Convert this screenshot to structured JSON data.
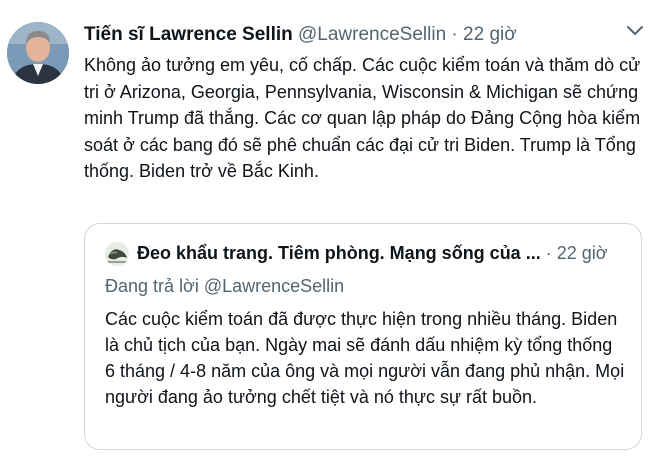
{
  "tweet": {
    "author_name": "Tiến sĩ Lawrence Sellin",
    "handle": "@LawrenceSellin",
    "separator": " · ",
    "time": "22 giờ",
    "text": "Không ảo tưởng em yêu, cố chấp. Các cuộc kiểm toán và thăm dò cử tri ở Arizona, Georgia, Pennsylvania, Wisconsin & Michigan sẽ chứng minh Trump đã thắng. Các cơ quan lập pháp do Đảng Cộng hòa kiểm soát ở các bang đó sẽ phê chuẩn các đại cử tri Biden. Trump là Tổng thống. Biden trở về Bắc Kinh.",
    "more_icon": "chevron-down-icon"
  },
  "quoted_tweet": {
    "author_name": "Đeo khẩu trang. Tiêm phòng. Mạng sống của ...",
    "separator": " · ",
    "time": "22 giờ",
    "reply_line": "Đang trả lời @LawrenceSellin",
    "text": "Các cuộc kiểm toán đã được thực hiện trong nhiều tháng. Biden là chủ tịch của bạn. Ngày mai sẽ đánh dấu nhiệm kỳ tổng thống 6 tháng / 4-8 năm của ông và mọi người vẫn đang phủ nhận. Mọi người đang ảo tưởng chết tiệt và nó thực sự rất buồn."
  },
  "colors": {
    "primary_text": "#0f1419",
    "secondary_text": "#536471",
    "border": "#cfd9de"
  }
}
